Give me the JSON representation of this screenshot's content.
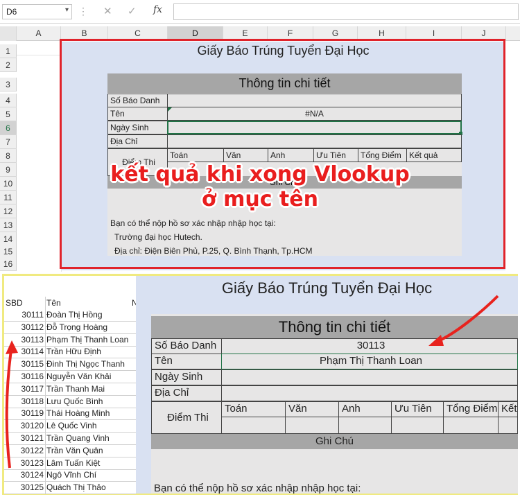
{
  "formula_bar": {
    "name_box": "D6",
    "fx": "fx",
    "cancel_icon": "✕",
    "enter_icon": "✓",
    "value": ""
  },
  "columns": [
    "A",
    "B",
    "C",
    "D",
    "E",
    "F",
    "G",
    "H",
    "I",
    "J"
  ],
  "rows": [
    "1",
    "2",
    "3",
    "4",
    "5",
    "6",
    "7",
    "8",
    "9",
    "10",
    "11",
    "12",
    "13",
    "14",
    "15",
    "16"
  ],
  "top_form": {
    "title": "Giấy Báo Trúng Tuyển Đại Học",
    "section": "Thông tin chi tiết",
    "labels": {
      "sbd": "Số Báo Danh",
      "ten": "Tên",
      "ngay_sinh": "Ngày Sinh",
      "dia_chi": "Địa Chỉ",
      "diem_thi": "Điểm Thi",
      "ghi_chu": "Ghi Chú"
    },
    "ten_value": "#N/A",
    "subjects": [
      "Toán",
      "Văn",
      "Anh",
      "Ưu Tiên",
      "Tổng Điểm",
      "Kết quả"
    ],
    "note_lines": [
      "Bạn có thể nộp hồ sơ xác nhập nhập học tại:",
      "Trường đại học Hutech.",
      "Địa chỉ: Điện Biên Phủ, P.25, Q. Bình Thạnh, Tp.HCM"
    ]
  },
  "overlay": {
    "line1": "kết quả khi xong Vlookup",
    "line2": "ở mục tên"
  },
  "list": {
    "headers": {
      "sbd": "SBD",
      "ten": "Tên",
      "extra": "N"
    },
    "rows": [
      {
        "sbd": "30111",
        "ten": "Đoàn Thị Hồng"
      },
      {
        "sbd": "30112",
        "ten": "Đỗ Trọng Hoàng"
      },
      {
        "sbd": "30113",
        "ten": "Phạm Thị Thanh Loan"
      },
      {
        "sbd": "30114",
        "ten": "Trần Hữu Định"
      },
      {
        "sbd": "30115",
        "ten": "Đinh Thị Ngọc Thanh"
      },
      {
        "sbd": "30116",
        "ten": "Nguyễn Văn Khải"
      },
      {
        "sbd": "30117",
        "ten": "Trần Thanh Mai"
      },
      {
        "sbd": "30118",
        "ten": "Lưu Quốc Bình"
      },
      {
        "sbd": "30119",
        "ten": "Thái Hoàng Minh"
      },
      {
        "sbd": "30120",
        "ten": "Lê Quốc Vinh"
      },
      {
        "sbd": "30121",
        "ten": "Trần Quang Vinh"
      },
      {
        "sbd": "30122",
        "ten": "Trần Văn Quân"
      },
      {
        "sbd": "30123",
        "ten": "Lâm Tuấn Kiệt"
      },
      {
        "sbd": "30124",
        "ten": "Ngô Vĩnh Chí"
      },
      {
        "sbd": "30125",
        "ten": "Quách Thị Thảo"
      }
    ]
  },
  "bottom_form": {
    "title": "Giấy Báo Trúng Tuyển Đại Học",
    "section": "Thông tin chi tiết",
    "sbd_value": "30113",
    "ten_value": "Phạm Thị Thanh Loan",
    "subjects": [
      "Toán",
      "Văn",
      "Anh",
      "Ưu Tiên",
      "Tổng Điểm",
      "Kết"
    ],
    "note_line": "Bạn có thể nộp hồ sơ xác nhập nhập học tại:"
  },
  "colors": {
    "border_red": "#e0232b",
    "border_yellow": "#f0ea80",
    "arrow_red": "#e8231e",
    "form_bg": "#d9e1f2",
    "header_gray": "#a6a6a6"
  }
}
